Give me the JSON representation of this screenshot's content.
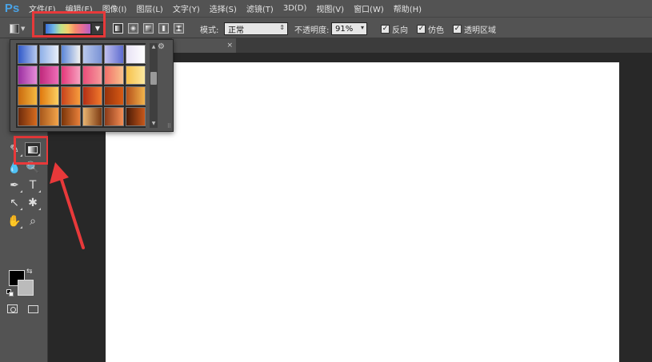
{
  "menubar": {
    "logo": "Ps",
    "items": [
      "文件(F)",
      "编辑(E)",
      "图像(I)",
      "图层(L)",
      "文字(Y)",
      "选择(S)",
      "滤镜(T)",
      "3D(D)",
      "视图(V)",
      "窗口(W)",
      "帮助(H)"
    ]
  },
  "options": {
    "mode_label": "模式:",
    "mode_value": "正常",
    "opacity_label": "不透明度:",
    "opacity_value": "91%",
    "reverse_label": "反向",
    "dither_label": "仿色",
    "transparency_label": "透明区域",
    "reverse_checked": true,
    "dither_checked": true,
    "transparency_checked": true
  },
  "document_tab": {
    "label": "",
    "close": "×"
  },
  "colors": {
    "accent_highlight": "#e8393a",
    "foreground": "#000000",
    "background": "#bbbbbb",
    "ui_panel": "#535353",
    "canvas": "#ffffff"
  },
  "gradient_presets": [
    [
      "#2f58c9:#b6c9ef",
      "#8fb0e8:#e8eef9",
      "#5b86d8:#f0f0f0",
      "#b9c8ec:#7a93d6",
      "#c0c0ee:#5d6bd0",
      "#e8e2f5:#ffffff"
    ],
    [
      "#9b2fa1:#e68cd8",
      "#c0297c:#ef6eb8",
      "#e4377a:#f7a1bf",
      "#ea4d7a:#f69b9b",
      "#f16f6a:#f9c28c",
      "#f6c14b:#fde9a0"
    ],
    [
      "#c96a0e:#f5b840",
      "#e0780d:#fbd062",
      "#c8421c:#f69d3d",
      "#b42e15:#f17a2c",
      "#97320b:#d85a14",
      "#b5501a:#f2b44c"
    ],
    [
      "#6d2b0c:#d66b1e",
      "#a8581c:#f3a54a",
      "#7a3409:#e8803a",
      "#e9b470:#7c3a12",
      "#8a3a18:#f58e55",
      "#4a1a06:#c8581a"
    ],
    [
      "#3b1608:#a8502a",
      "#c3a23c:#3d2a0c",
      "#221a40:#7d4b8c",
      "#1c2850:#9e6eb0",
      "#2c1e5a:#c48cda",
      "#3a2a70:#d3a9e3"
    ]
  ]
}
